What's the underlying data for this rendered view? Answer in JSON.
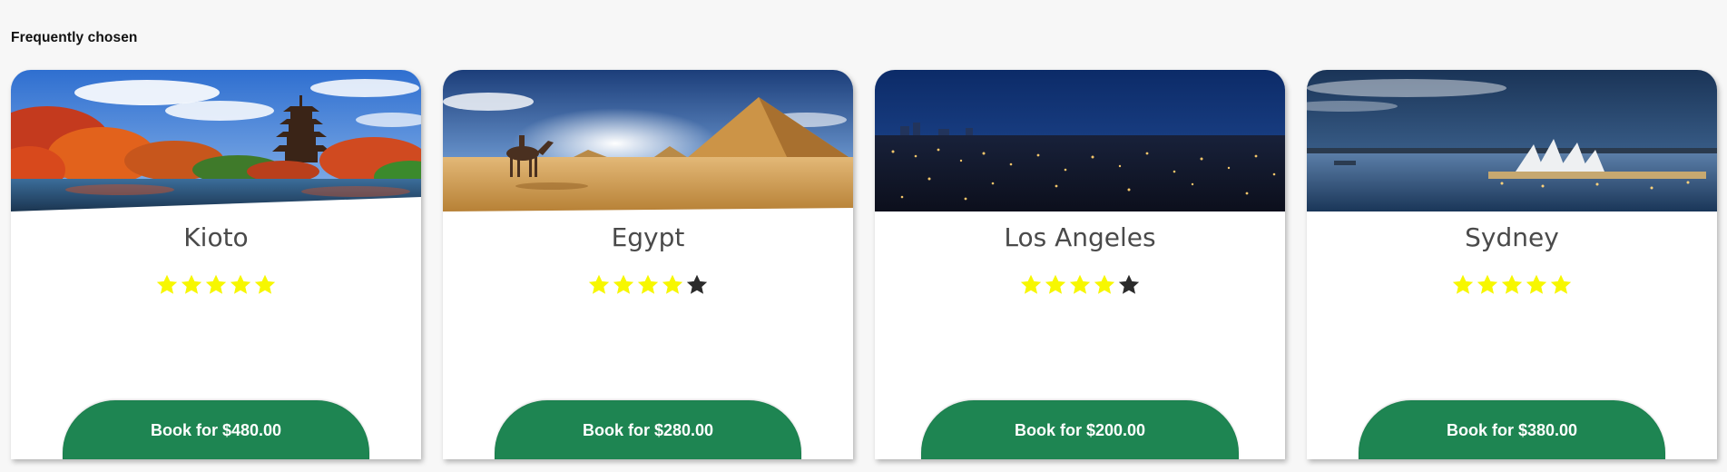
{
  "section": {
    "title": "Frequently chosen"
  },
  "colors": {
    "button": "#1e8552",
    "star_filled": "#f7f700",
    "star_empty": "#2b2b2b"
  },
  "cards": [
    {
      "name": "Kioto",
      "rating": 5,
      "max_rating": 5,
      "button_label": "Book for $480.00",
      "image_icon": "kyoto-pagoda-autumn-image"
    },
    {
      "name": "Egypt",
      "rating": 4,
      "max_rating": 5,
      "button_label": "Book for $280.00",
      "image_icon": "egypt-pyramids-camel-image"
    },
    {
      "name": "Los Angeles",
      "rating": 4,
      "max_rating": 5,
      "button_label": "Book for $200.00",
      "image_icon": "los-angeles-night-skyline-image"
    },
    {
      "name": "Sydney",
      "rating": 5,
      "max_rating": 5,
      "button_label": "Book for $380.00",
      "image_icon": "sydney-opera-house-image"
    }
  ]
}
